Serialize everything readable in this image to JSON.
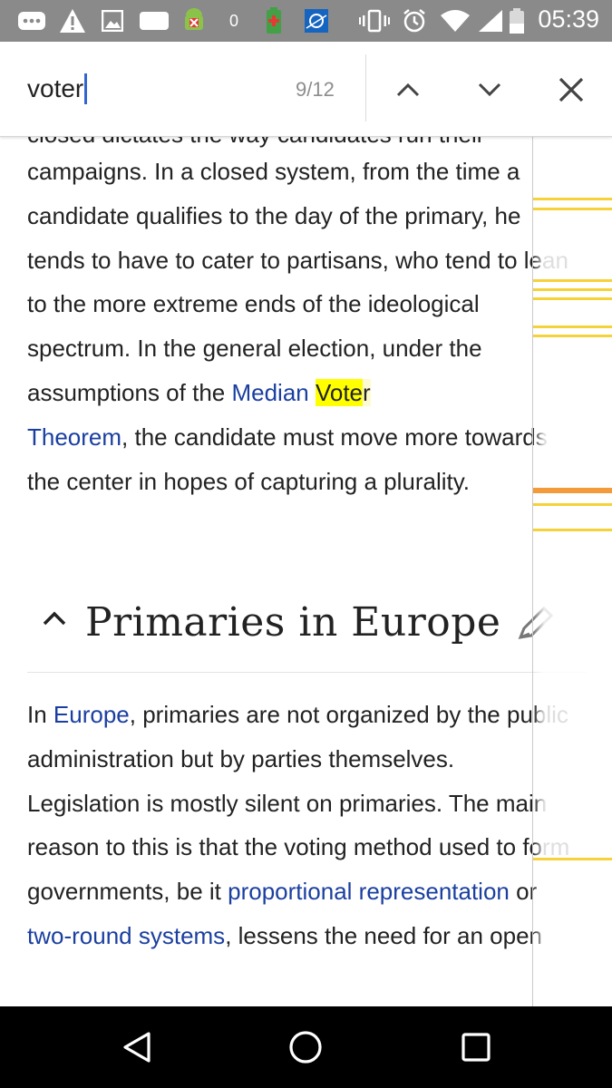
{
  "status_bar": {
    "time": "05:39",
    "notification_count": "0",
    "icons": [
      "more-icon",
      "warning-icon",
      "image-icon",
      "message-icon",
      "android-debug-icon",
      "zero-badge",
      "battery-saver-icon",
      "news-icon",
      "vibrate-icon",
      "alarm-icon",
      "wifi-icon",
      "signal-icon",
      "battery-icon"
    ]
  },
  "find": {
    "query": "voter",
    "count": "9/12",
    "prev_icon": "chevron-up-icon",
    "next_icon": "chevron-down-icon",
    "close_icon": "close-icon"
  },
  "article": {
    "clipped_top": "closed dictates the way candidates run their",
    "para1": {
      "text_a": "campaigns. In a closed system, from the time a candidate qualifies to the day of the primary, he tends to have to cater to partisans, who tend to lean to the more extreme ends of the ideological spectrum. In the general election, under the assumptions of the ",
      "link_median": "Median ",
      "highlight": "Vote",
      "highlight_rest": "r",
      "link_theorem": "Theorem",
      "text_b": ", the candidate must move more towards the center in hopes of capturing a plurality."
    },
    "section": {
      "title": "Primaries in Europe",
      "collapse_icon": "chevron-up-icon",
      "edit_icon": "pencil-icon"
    },
    "para2": {
      "t1": "In ",
      "link_europe": "Europe",
      "t2": ", primaries are not organized by the public administration but by parties themselves. Legislation is mostly silent on primaries. The main reason to this is that the voting method used to form governments, be it ",
      "link_pr": "proportional representation",
      "t3": " or ",
      "link_tr": "two-round systems",
      "t4": ", lessens the need for an open"
    }
  },
  "colors": {
    "active_match": "#ffff00",
    "passive_match": "#fffbd0",
    "link": "#1a3fa0",
    "scroll_mark": "#f6d23a",
    "scroll_mark_active": "#f39a3a"
  },
  "nav_bar": {
    "back_icon": "back-icon",
    "home_icon": "home-icon",
    "recents_icon": "recents-icon"
  }
}
